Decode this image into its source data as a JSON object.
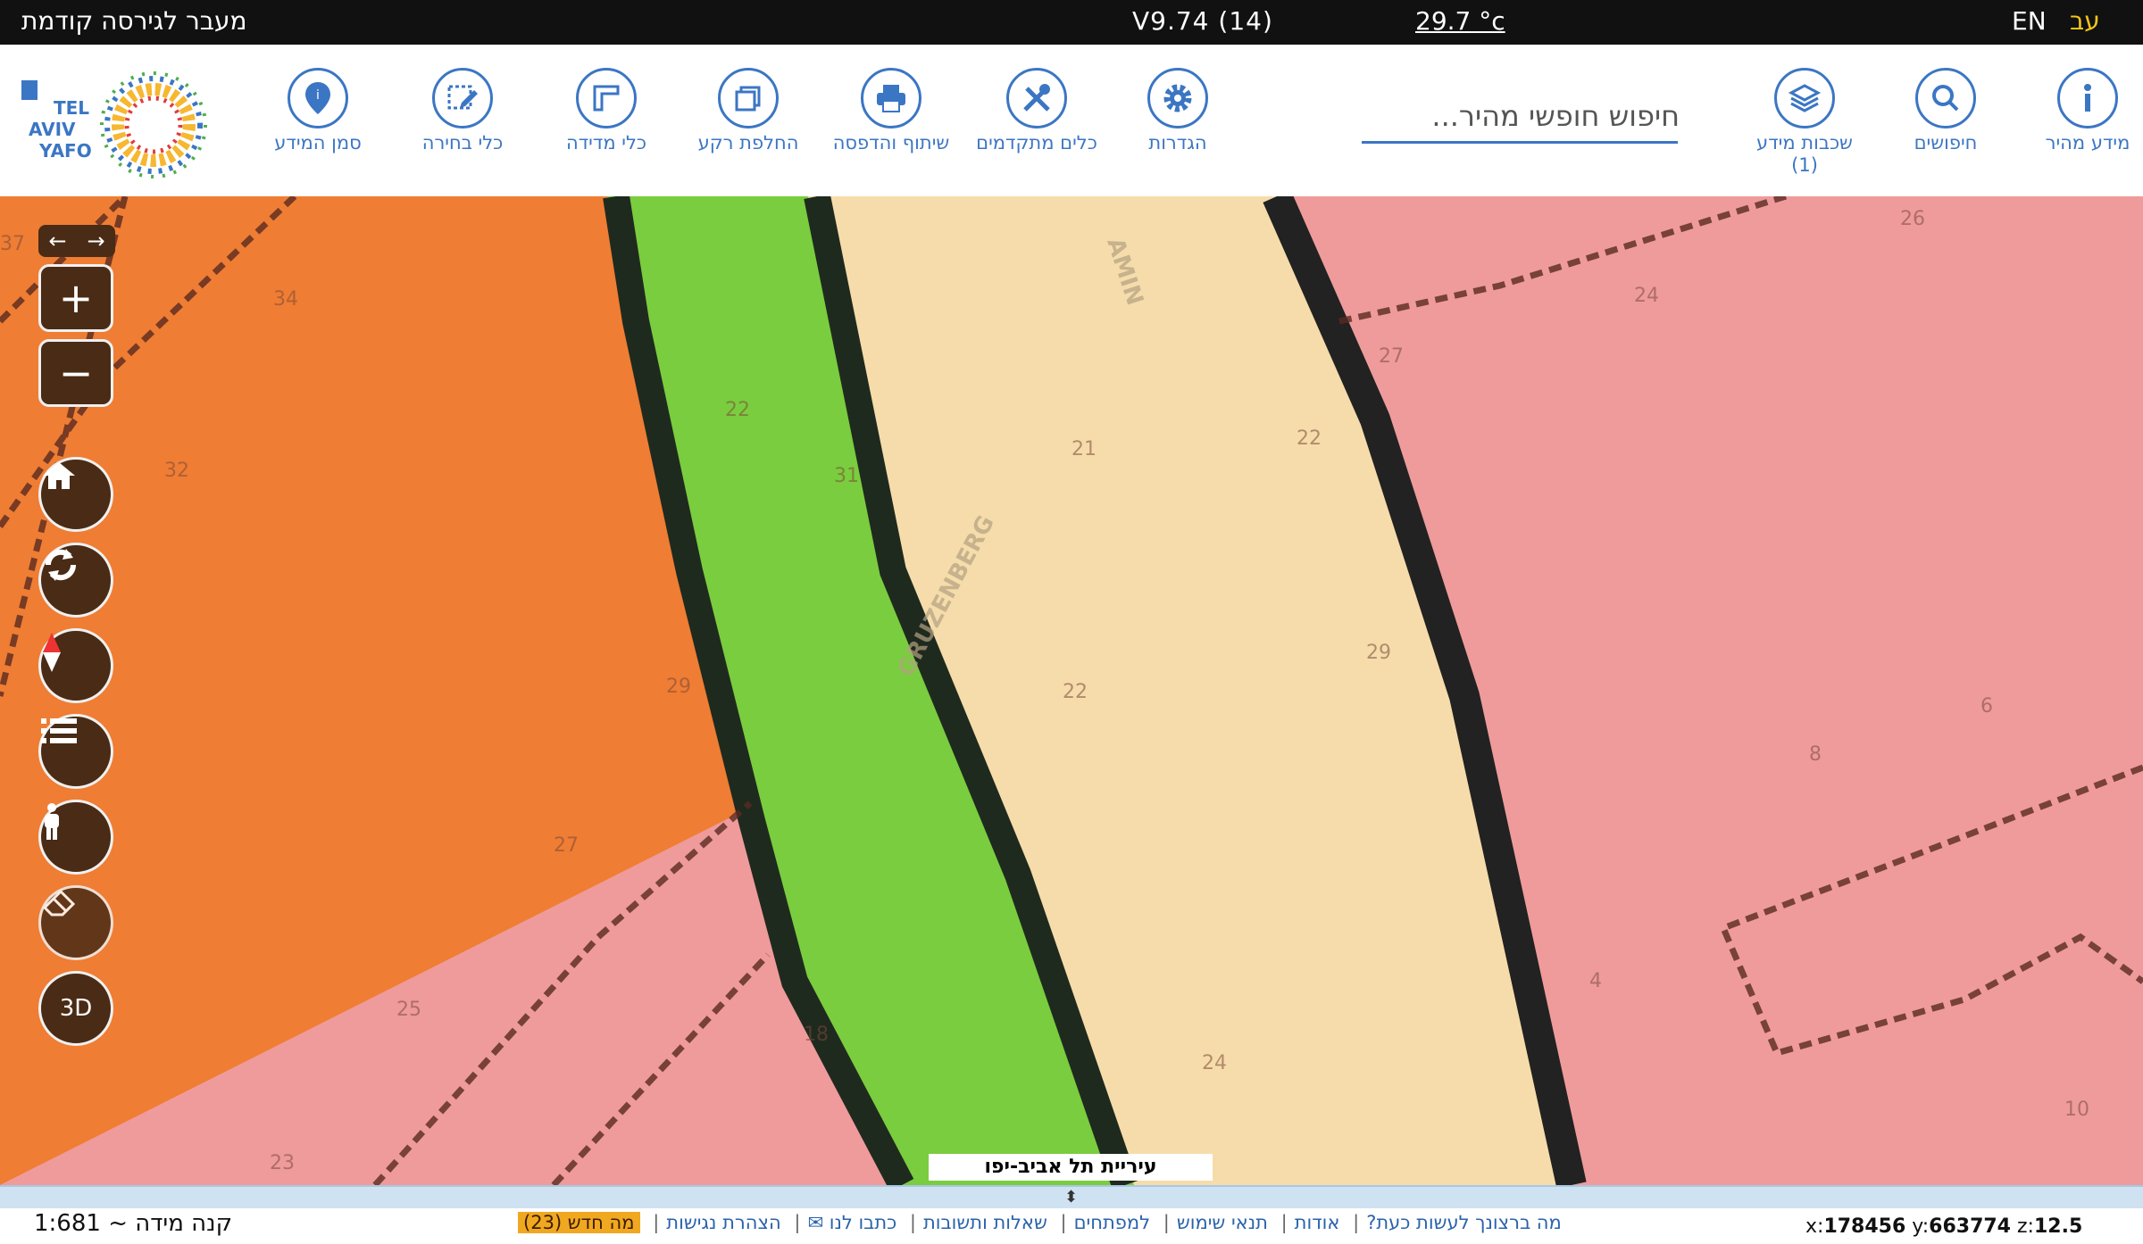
{
  "topbar": {
    "prev_version": "מעבר לגירסה קודמת",
    "version": "V9.74 (14)",
    "weather": "29.7 °c",
    "lang_en": "EN",
    "lang_he": "עב"
  },
  "toolbar": {
    "tools_left": [
      {
        "label": "סמן המידע",
        "icon": "info-marker-icon"
      },
      {
        "label": "כלי בחירה",
        "icon": "select-tool-icon"
      },
      {
        "label": "כלי מדידה",
        "icon": "measure-tool-icon"
      },
      {
        "label": "החלפת רקע",
        "icon": "layers-swap-icon"
      },
      {
        "label": "שיתוף והדפסה",
        "icon": "print-icon"
      },
      {
        "label": "כלים מתקדמים",
        "icon": "tools-icon"
      },
      {
        "label": "הגדרות",
        "icon": "gear-icon"
      }
    ],
    "search_placeholder": "חיפוש חופשי מהיר...",
    "tools_right": [
      {
        "label": "שכבות מידע",
        "badge": "(1)",
        "icon": "layers-icon"
      },
      {
        "label": "חיפושים",
        "icon": "search-icon"
      },
      {
        "label": "מידע מהיר",
        "icon": "info-icon"
      }
    ],
    "logo_text": "TEL AVIV YAFO תל אביב יפו"
  },
  "map": {
    "city_label": "עיריית תל אביב-יפו",
    "street_labels": [
      "GRUZENBERG",
      "AMIN"
    ],
    "parcel_numbers": [
      "37",
      "34",
      "32",
      "29",
      "27",
      "25",
      "23",
      "22",
      "31",
      "22",
      "24",
      "18",
      "26",
      "24",
      "27",
      "22",
      "29",
      "6",
      "8",
      "10",
      "4",
      "21"
    ],
    "legend_colors": {
      "residential_a": "#ef7d33",
      "public_open_space": "#7acd3e",
      "road": "#f6dcaa",
      "residential_b": "#ef9b9b",
      "boundary": "#222222"
    },
    "controls": {
      "zoom_in": "+",
      "zoom_out": "−",
      "btn_3d": "3D"
    }
  },
  "bottom": {
    "scale_label": "קנה מידה ~ 1:681",
    "links": [
      "מה ברצונך לעשות כעת?",
      "אודות",
      "תנאי שימוש",
      "למפתחים",
      "שאלות ותשובות",
      "כתבו לנו ✉",
      "הצהרת נגישות"
    ],
    "whats_new": "מה חדש (23)",
    "coords": {
      "x_label": "x:",
      "x": "178456",
      "y_label": "y:",
      "y": "663774",
      "z_label": "z:",
      "z": "12.5"
    }
  }
}
